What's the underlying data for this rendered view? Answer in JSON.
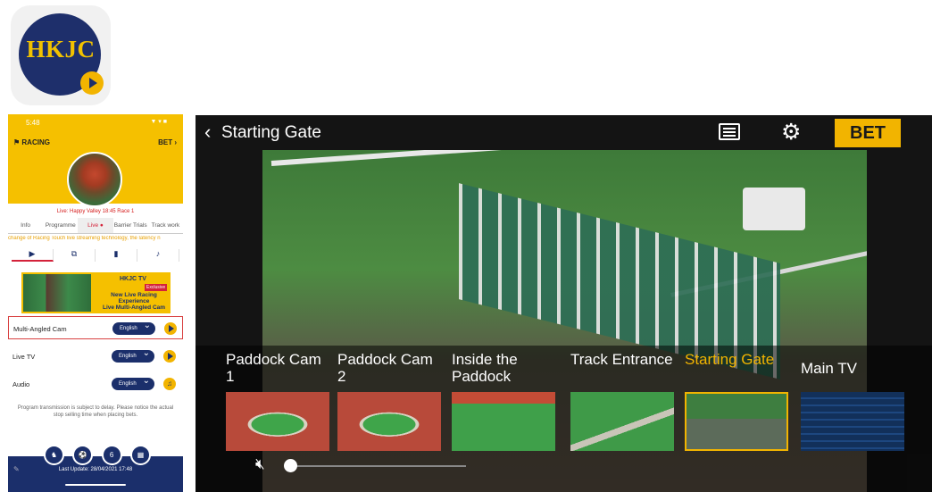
{
  "app_icon": {
    "text": "HKJC",
    "icon": "play-icon"
  },
  "phone": {
    "status_time": "5:48",
    "status_right": "▼ ▾ ■",
    "section": "RACING",
    "bet": "BET",
    "live_line": "Live: Happy Valley 18:45 Race 1",
    "tabs": [
      "Info",
      "Programme",
      "Live",
      "Barrier Trials",
      "Track work"
    ],
    "active_tab": "Live",
    "ticker": "change of Racing Touch live streaming technology, the latency n",
    "banner": {
      "logo": "HKJC TV",
      "badge": "Exclusive",
      "line1": "New Live Racing",
      "line2": "Experience",
      "line3": "Live Multi-Angled Cam"
    },
    "rows": [
      {
        "label": "Multi-Angled Cam",
        "language": "English",
        "action": "play-icon"
      },
      {
        "label": "Live TV",
        "language": "English",
        "action": "play-icon"
      },
      {
        "label": "Audio",
        "language": "English",
        "action": "headphones-icon"
      }
    ],
    "notice": "Program transmission is subject to delay. Please notice the actual stop selling time when placing bets.",
    "last_update": "Last Update: 28/04/2021 17:48",
    "dock_icons": [
      "horse-icon",
      "football-icon",
      "six-icon",
      "calendar-icon"
    ]
  },
  "player": {
    "title": "Starting Gate",
    "bet_label": "BET",
    "cameras": [
      {
        "label": "Paddock Cam 1",
        "thumb": "t-oval",
        "active": false
      },
      {
        "label": "Paddock Cam 2",
        "thumb": "t-oval",
        "active": false
      },
      {
        "label": "Inside the Paddock",
        "thumb": "t-paddock",
        "active": false
      },
      {
        "label": "Track Entrance",
        "thumb": "t-track",
        "active": false
      },
      {
        "label": "Starting Gate",
        "thumb": "t-gate",
        "active": true
      },
      {
        "label": "Main TV",
        "thumb": "t-maintv",
        "active": false
      }
    ],
    "volume": 0,
    "accent": "#F2B400"
  }
}
